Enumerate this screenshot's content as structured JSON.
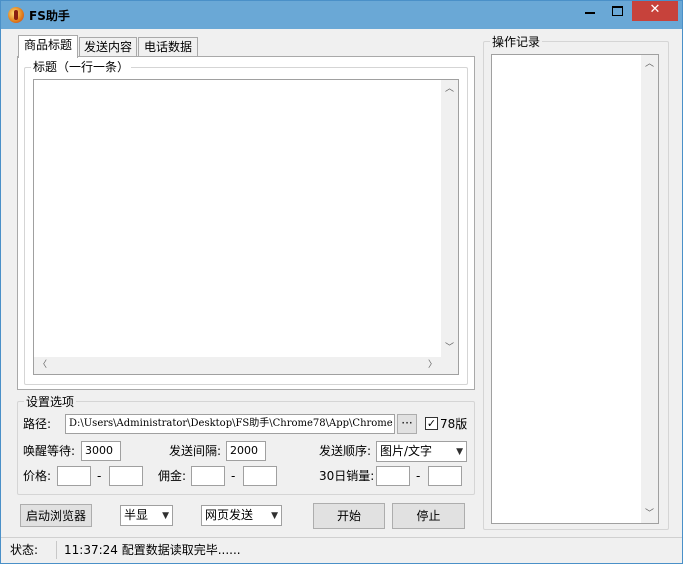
{
  "window": {
    "title": "FS助手",
    "buttons": {
      "minimize": "",
      "maximize": "",
      "close": "✕"
    }
  },
  "tabs": [
    "商品标题",
    "发送内容",
    "电话数据"
  ],
  "title_group": {
    "label": "标题（一行一条）",
    "content": ""
  },
  "log_group": {
    "label": "操作记录",
    "content": ""
  },
  "settings": {
    "label": "设置选项",
    "path_label": "路径:",
    "path_value": "D:\\Users\\Administrator\\Desktop\\FS助手\\Chrome78\\App\\Chrome",
    "browse_label": "···",
    "chrome78_label": "78版",
    "chrome78_checked": true,
    "wake_wait_label": "唤醒等待:",
    "wake_wait_value": "3000",
    "send_interval_label": "发送间隔:",
    "send_interval_value": "2000",
    "send_order_label": "发送顺序:",
    "send_order_value": "图片/文字",
    "price_label": "价格:",
    "price_min": "",
    "price_max": "",
    "commission_label": "佣金:",
    "commission_min": "",
    "commission_max": "",
    "sales30_label": "30日销量:",
    "sales30_min": "",
    "sales30_max": "",
    "dash": "-"
  },
  "controls": {
    "launch_browser": "启动浏览器",
    "display_mode": "半显",
    "send_mode": "网页发送",
    "start": "开始",
    "stop": "停止"
  },
  "status": {
    "label": "状态:",
    "message": "11:37:24 配置数据读取完毕......"
  }
}
